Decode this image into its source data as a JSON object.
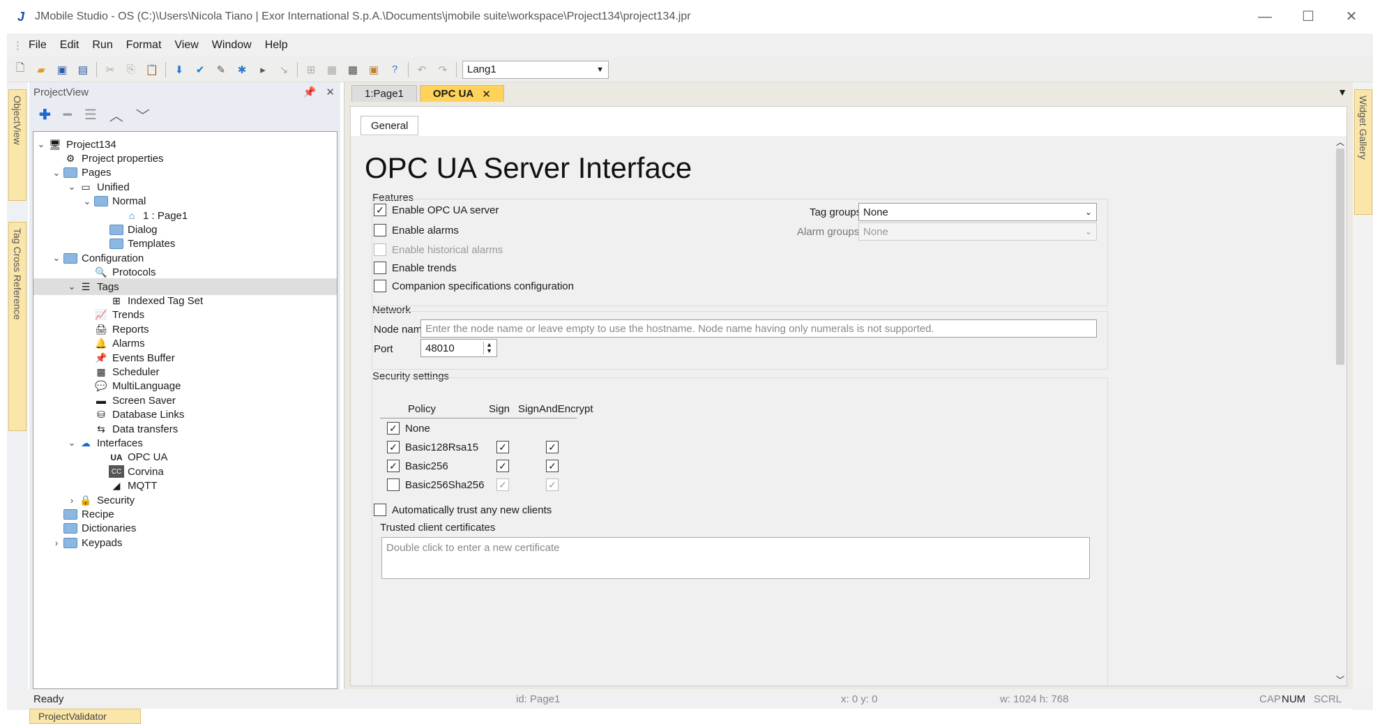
{
  "app": {
    "title": "JMobile Studio - OS (C:)\\Users\\Nicola Tiano | Exor International S.p.A.\\Documents\\jmobile suite\\workspace\\Project134\\project134.jpr",
    "logo": "J"
  },
  "menu": [
    "File",
    "Edit",
    "Run",
    "Format",
    "View",
    "Window",
    "Help"
  ],
  "toolbar": {
    "language": "Lang1"
  },
  "left_strip": {
    "object_view": "ObjectView",
    "tag_xref": "Tag Cross Reference"
  },
  "right_strip": {
    "widget_gallery": "Widget Gallery"
  },
  "project_view": {
    "title": "ProjectView",
    "tree": [
      {
        "label": "Project134",
        "indent": 0,
        "twisty": "v",
        "icon": "computer-icon"
      },
      {
        "label": "Project properties",
        "indent": 1,
        "twisty": "",
        "icon": "properties-icon"
      },
      {
        "label": "Pages",
        "indent": 1,
        "twisty": "v",
        "icon": "folder-icon"
      },
      {
        "label": "Unified",
        "indent": 2,
        "twisty": "v",
        "icon": "page-group-icon"
      },
      {
        "label": "Normal",
        "indent": 3,
        "twisty": "v",
        "icon": "folder-icon"
      },
      {
        "label": "1 : Page1",
        "indent": 5,
        "twisty": "",
        "icon": "home-icon"
      },
      {
        "label": "Dialog",
        "indent": 4,
        "twisty": "",
        "icon": "folder-icon"
      },
      {
        "label": "Templates",
        "indent": 4,
        "twisty": "",
        "icon": "folder-icon"
      },
      {
        "label": "Configuration",
        "indent": 1,
        "twisty": "v",
        "icon": "folder-icon"
      },
      {
        "label": "Protocols",
        "indent": 3,
        "twisty": "",
        "icon": "protocol-icon"
      },
      {
        "label": "Tags",
        "indent": 2,
        "twisty": "v",
        "icon": "tags-icon",
        "selected": true
      },
      {
        "label": "Indexed Tag Set",
        "indent": 4,
        "twisty": "",
        "icon": "tag-set-icon"
      },
      {
        "label": "Trends",
        "indent": 3,
        "twisty": "",
        "icon": "trend-icon"
      },
      {
        "label": "Reports",
        "indent": 3,
        "twisty": "",
        "icon": "printer-icon"
      },
      {
        "label": "Alarms",
        "indent": 3,
        "twisty": "",
        "icon": "bell-icon"
      },
      {
        "label": "Events Buffer",
        "indent": 3,
        "twisty": "",
        "icon": "pin-icon"
      },
      {
        "label": "Scheduler",
        "indent": 3,
        "twisty": "",
        "icon": "calendar-icon"
      },
      {
        "label": "MultiLanguage",
        "indent": 3,
        "twisty": "",
        "icon": "speech-icon"
      },
      {
        "label": "Screen Saver",
        "indent": 3,
        "twisty": "",
        "icon": "screen-icon"
      },
      {
        "label": "Database Links",
        "indent": 3,
        "twisty": "",
        "icon": "database-icon"
      },
      {
        "label": "Data transfers",
        "indent": 3,
        "twisty": "",
        "icon": "transfer-icon"
      },
      {
        "label": "Interfaces",
        "indent": 2,
        "twisty": "v",
        "icon": "cloud-icon"
      },
      {
        "label": "OPC UA",
        "indent": 4,
        "twisty": "",
        "icon": "ua-icon"
      },
      {
        "label": "Corvina",
        "indent": 4,
        "twisty": "",
        "icon": "corvina-icon"
      },
      {
        "label": "MQTT",
        "indent": 4,
        "twisty": "",
        "icon": "mqtt-icon"
      },
      {
        "label": "Security",
        "indent": 2,
        "twisty": ">",
        "icon": "lock-icon"
      },
      {
        "label": "Recipe",
        "indent": 1,
        "twisty": "",
        "icon": "folder-icon"
      },
      {
        "label": "Dictionaries",
        "indent": 1,
        "twisty": "",
        "icon": "folder-icon"
      },
      {
        "label": "Keypads",
        "indent": 1,
        "twisty": ">",
        "icon": "folder-icon"
      }
    ]
  },
  "tabs": [
    {
      "label": "1:Page1",
      "active": false
    },
    {
      "label": "OPC UA",
      "active": true
    }
  ],
  "opcua": {
    "subtab": "General",
    "heading": "OPC UA Server Interface",
    "features": {
      "title": "Features",
      "enable_server": {
        "label": "Enable OPC UA server",
        "checked": true
      },
      "enable_alarms": {
        "label": "Enable alarms",
        "checked": false
      },
      "enable_hist_alarms": {
        "label": "Enable historical alarms",
        "checked": false,
        "disabled": true
      },
      "enable_trends": {
        "label": "Enable trends",
        "checked": false
      },
      "companion": {
        "label": "Companion specifications configuration",
        "checked": false
      },
      "tag_groups_label": "Tag groups:",
      "tag_groups_value": "None",
      "alarm_groups_label": "Alarm groups:",
      "alarm_groups_value": "None"
    },
    "network": {
      "title": "Network",
      "node_name_label": "Node name",
      "node_name_placeholder": "Enter the node name or leave empty to use the hostname. Node name having only numerals is not supported.",
      "port_label": "Port",
      "port_value": "48010"
    },
    "security": {
      "title": "Security settings",
      "col_policy": "Policy",
      "col_sign": "Sign",
      "col_signencrypt": "SignAndEncrypt",
      "rows": [
        {
          "name": "None",
          "checked": true,
          "sign": null,
          "enc": null
        },
        {
          "name": "Basic128Rsa15",
          "checked": true,
          "sign": true,
          "enc": true
        },
        {
          "name": "Basic256",
          "checked": true,
          "sign": true,
          "enc": true
        },
        {
          "name": "Basic256Sha256",
          "checked": false,
          "sign": true,
          "enc": true,
          "dim": true
        }
      ],
      "auto_trust": {
        "label": "Automatically trust any new clients",
        "checked": false
      },
      "trusted_title": "Trusted client certificates",
      "trusted_placeholder": "Double click to enter a new certificate"
    }
  },
  "status": {
    "ready": "Ready",
    "id": "id:  Page1",
    "xy": "x: 0    y: 0",
    "wh": "w: 1024    h: 768",
    "cap": "CAP",
    "num": "NUM",
    "scrl": "SCRL"
  },
  "bottom_tab": "ProjectValidator"
}
